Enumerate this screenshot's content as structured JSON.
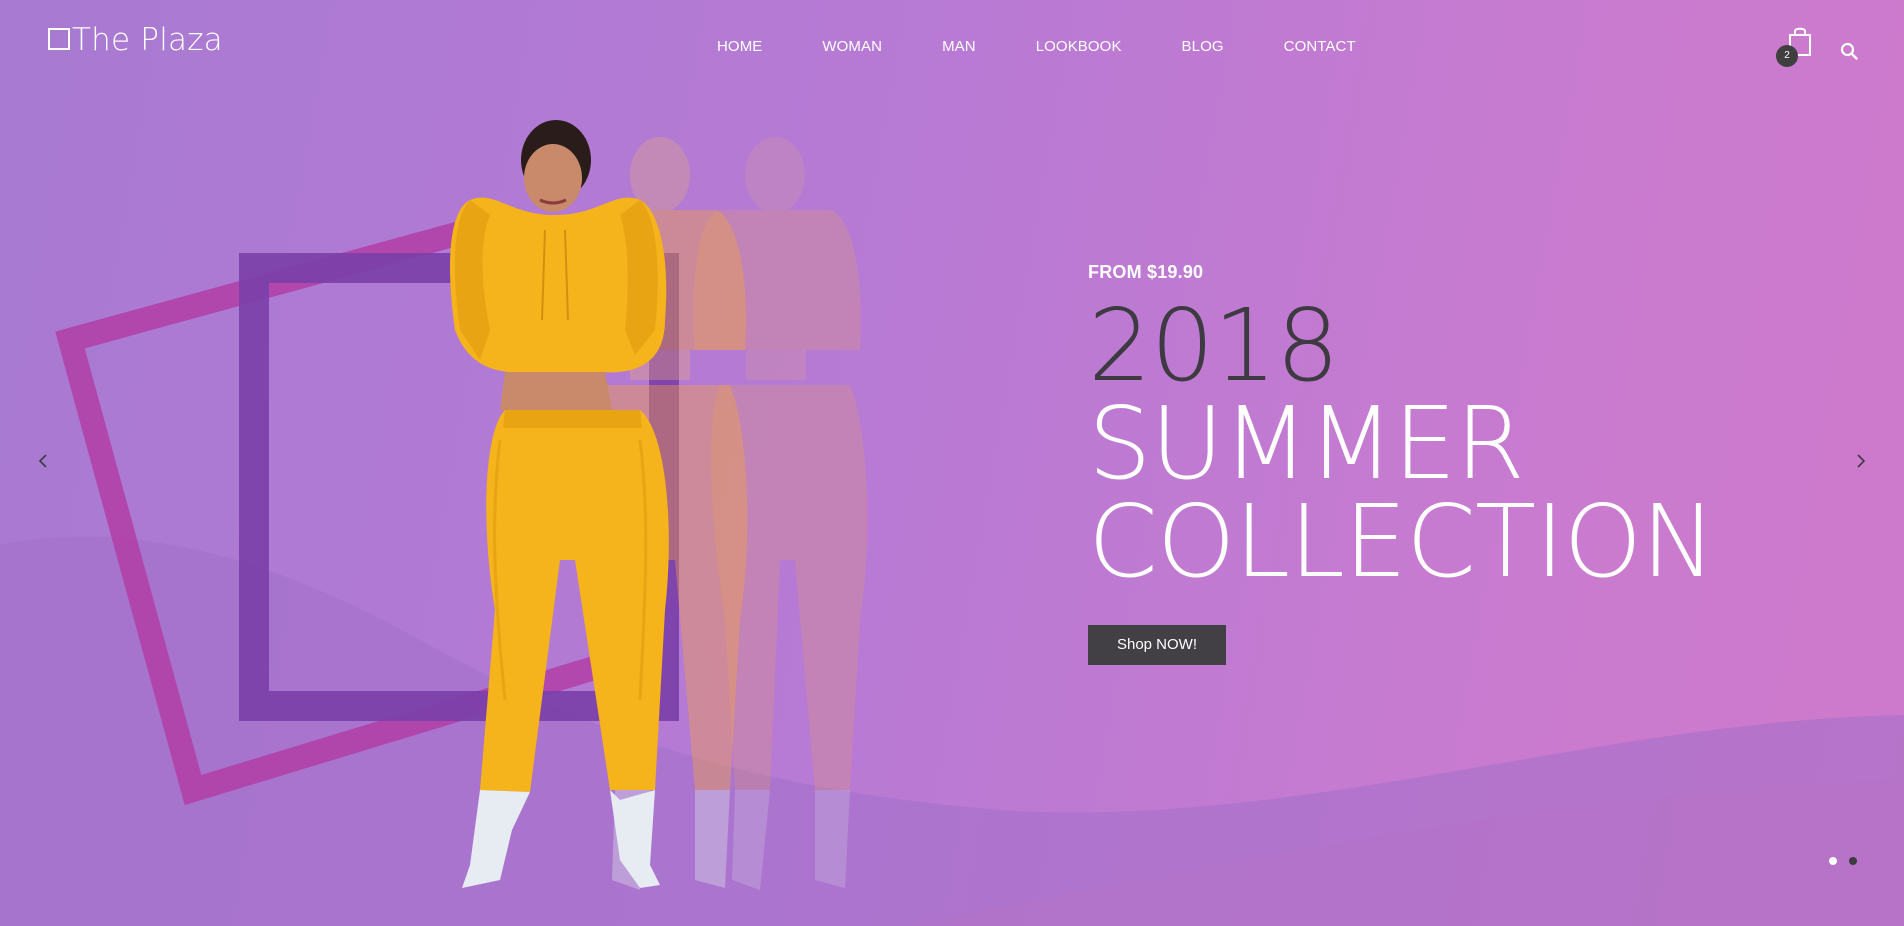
{
  "header": {
    "logo_text": "The Plaza",
    "nav": [
      {
        "label": "HOME"
      },
      {
        "label": "WOMAN"
      },
      {
        "label": "MAN"
      },
      {
        "label": "LOOKBOOK"
      },
      {
        "label": "BLOG"
      },
      {
        "label": "CONTACT"
      }
    ],
    "cart_count": "2",
    "cart_icon": "shopping-bag-icon",
    "search_icon": "search-icon"
  },
  "hero": {
    "price": "FROM $19.90",
    "headline_year": "2018",
    "headline_line1": "SUMMER",
    "headline_line2": "COLLECTION",
    "cta_label": "Shop NOW!",
    "prev_icon": "chevron-left-icon",
    "next_icon": "chevron-right-icon",
    "slides": [
      {
        "active": true
      },
      {
        "active": false
      }
    ]
  },
  "colors": {
    "background_start": "#a87ad2",
    "background_end": "#cf7acb",
    "button": "#434045",
    "year_text": "#3d3a42",
    "outfit_yellow": "#f5b31c",
    "frame_purple": "#7a3fa8",
    "frame_magenta": "#b13ea6"
  }
}
